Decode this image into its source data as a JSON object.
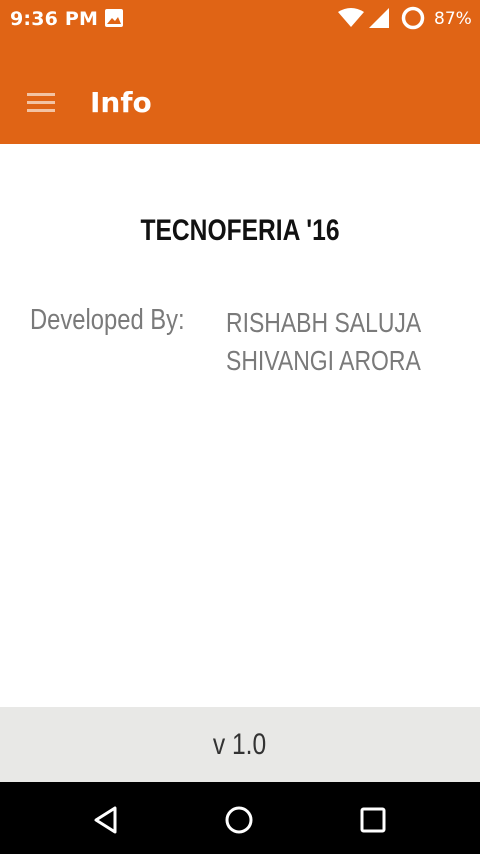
{
  "status_bar": {
    "time": "9:36 PM",
    "battery_percent": "87%",
    "icons": [
      "gallery-notification-icon",
      "wifi-icon",
      "cell-signal-icon",
      "battery-saver-icon"
    ]
  },
  "app_bar": {
    "title": "Info",
    "menu_icon": "hamburger-menu-icon",
    "color": "#e06415"
  },
  "content": {
    "event_title": "TECNOFERIA '16",
    "developed_by_label": "Developed By:",
    "developers": [
      "RISHABH SALUJA",
      "SHIVANGI ARORA"
    ]
  },
  "footer": {
    "version": "v 1.0"
  },
  "nav_bar": {
    "buttons": [
      "back-icon",
      "home-icon",
      "recents-icon"
    ]
  }
}
